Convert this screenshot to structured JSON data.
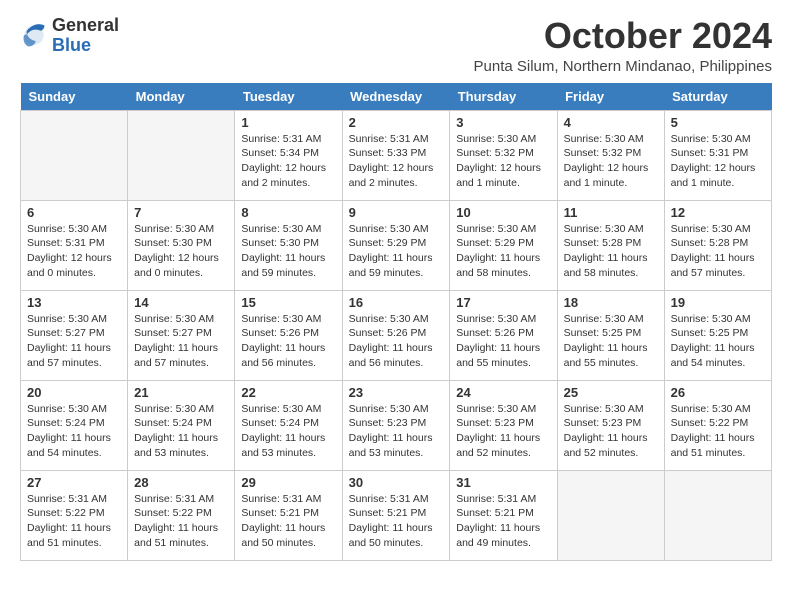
{
  "header": {
    "logo_general": "General",
    "logo_blue": "Blue",
    "month_title": "October 2024",
    "location": "Punta Silum, Northern Mindanao, Philippines"
  },
  "calendar": {
    "headers": [
      "Sunday",
      "Monday",
      "Tuesday",
      "Wednesday",
      "Thursday",
      "Friday",
      "Saturday"
    ],
    "weeks": [
      [
        {
          "day": "",
          "info": ""
        },
        {
          "day": "",
          "info": ""
        },
        {
          "day": "1",
          "info": "Sunrise: 5:31 AM\nSunset: 5:34 PM\nDaylight: 12 hours and 2 minutes."
        },
        {
          "day": "2",
          "info": "Sunrise: 5:31 AM\nSunset: 5:33 PM\nDaylight: 12 hours and 2 minutes."
        },
        {
          "day": "3",
          "info": "Sunrise: 5:30 AM\nSunset: 5:32 PM\nDaylight: 12 hours and 1 minute."
        },
        {
          "day": "4",
          "info": "Sunrise: 5:30 AM\nSunset: 5:32 PM\nDaylight: 12 hours and 1 minute."
        },
        {
          "day": "5",
          "info": "Sunrise: 5:30 AM\nSunset: 5:31 PM\nDaylight: 12 hours and 1 minute."
        }
      ],
      [
        {
          "day": "6",
          "info": "Sunrise: 5:30 AM\nSunset: 5:31 PM\nDaylight: 12 hours and 0 minutes."
        },
        {
          "day": "7",
          "info": "Sunrise: 5:30 AM\nSunset: 5:30 PM\nDaylight: 12 hours and 0 minutes."
        },
        {
          "day": "8",
          "info": "Sunrise: 5:30 AM\nSunset: 5:30 PM\nDaylight: 11 hours and 59 minutes."
        },
        {
          "day": "9",
          "info": "Sunrise: 5:30 AM\nSunset: 5:29 PM\nDaylight: 11 hours and 59 minutes."
        },
        {
          "day": "10",
          "info": "Sunrise: 5:30 AM\nSunset: 5:29 PM\nDaylight: 11 hours and 58 minutes."
        },
        {
          "day": "11",
          "info": "Sunrise: 5:30 AM\nSunset: 5:28 PM\nDaylight: 11 hours and 58 minutes."
        },
        {
          "day": "12",
          "info": "Sunrise: 5:30 AM\nSunset: 5:28 PM\nDaylight: 11 hours and 57 minutes."
        }
      ],
      [
        {
          "day": "13",
          "info": "Sunrise: 5:30 AM\nSunset: 5:27 PM\nDaylight: 11 hours and 57 minutes."
        },
        {
          "day": "14",
          "info": "Sunrise: 5:30 AM\nSunset: 5:27 PM\nDaylight: 11 hours and 57 minutes."
        },
        {
          "day": "15",
          "info": "Sunrise: 5:30 AM\nSunset: 5:26 PM\nDaylight: 11 hours and 56 minutes."
        },
        {
          "day": "16",
          "info": "Sunrise: 5:30 AM\nSunset: 5:26 PM\nDaylight: 11 hours and 56 minutes."
        },
        {
          "day": "17",
          "info": "Sunrise: 5:30 AM\nSunset: 5:26 PM\nDaylight: 11 hours and 55 minutes."
        },
        {
          "day": "18",
          "info": "Sunrise: 5:30 AM\nSunset: 5:25 PM\nDaylight: 11 hours and 55 minutes."
        },
        {
          "day": "19",
          "info": "Sunrise: 5:30 AM\nSunset: 5:25 PM\nDaylight: 11 hours and 54 minutes."
        }
      ],
      [
        {
          "day": "20",
          "info": "Sunrise: 5:30 AM\nSunset: 5:24 PM\nDaylight: 11 hours and 54 minutes."
        },
        {
          "day": "21",
          "info": "Sunrise: 5:30 AM\nSunset: 5:24 PM\nDaylight: 11 hours and 53 minutes."
        },
        {
          "day": "22",
          "info": "Sunrise: 5:30 AM\nSunset: 5:24 PM\nDaylight: 11 hours and 53 minutes."
        },
        {
          "day": "23",
          "info": "Sunrise: 5:30 AM\nSunset: 5:23 PM\nDaylight: 11 hours and 53 minutes."
        },
        {
          "day": "24",
          "info": "Sunrise: 5:30 AM\nSunset: 5:23 PM\nDaylight: 11 hours and 52 minutes."
        },
        {
          "day": "25",
          "info": "Sunrise: 5:30 AM\nSunset: 5:23 PM\nDaylight: 11 hours and 52 minutes."
        },
        {
          "day": "26",
          "info": "Sunrise: 5:30 AM\nSunset: 5:22 PM\nDaylight: 11 hours and 51 minutes."
        }
      ],
      [
        {
          "day": "27",
          "info": "Sunrise: 5:31 AM\nSunset: 5:22 PM\nDaylight: 11 hours and 51 minutes."
        },
        {
          "day": "28",
          "info": "Sunrise: 5:31 AM\nSunset: 5:22 PM\nDaylight: 11 hours and 51 minutes."
        },
        {
          "day": "29",
          "info": "Sunrise: 5:31 AM\nSunset: 5:21 PM\nDaylight: 11 hours and 50 minutes."
        },
        {
          "day": "30",
          "info": "Sunrise: 5:31 AM\nSunset: 5:21 PM\nDaylight: 11 hours and 50 minutes."
        },
        {
          "day": "31",
          "info": "Sunrise: 5:31 AM\nSunset: 5:21 PM\nDaylight: 11 hours and 49 minutes."
        },
        {
          "day": "",
          "info": ""
        },
        {
          "day": "",
          "info": ""
        }
      ]
    ]
  }
}
